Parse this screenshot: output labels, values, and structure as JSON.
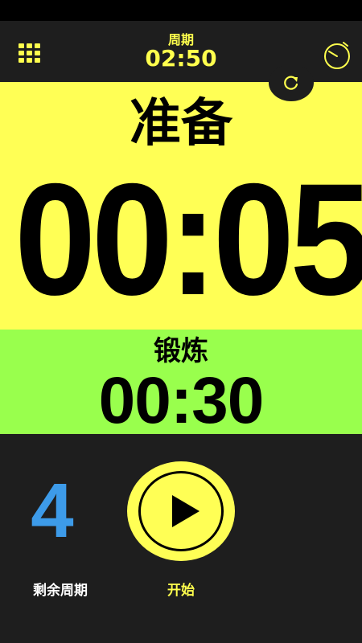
{
  "header": {
    "cycle_label": "周期",
    "cycle_time": "02:50",
    "menu_icon": "grid-icon",
    "timer_icon": "stopwatch-icon"
  },
  "prep": {
    "label": "准备",
    "time": "00:05",
    "reset_icon": "refresh-icon"
  },
  "work": {
    "label": "锻炼",
    "time": "00:30"
  },
  "bottom": {
    "remaining_count": "4",
    "remaining_label": "剩余周期",
    "start_label": "开始",
    "start_icon": "play-icon"
  },
  "colors": {
    "accent_yellow": "#ffff55",
    "work_green": "#99ff4d",
    "count_blue": "#3d9be9",
    "background": "#1e1e1e"
  }
}
